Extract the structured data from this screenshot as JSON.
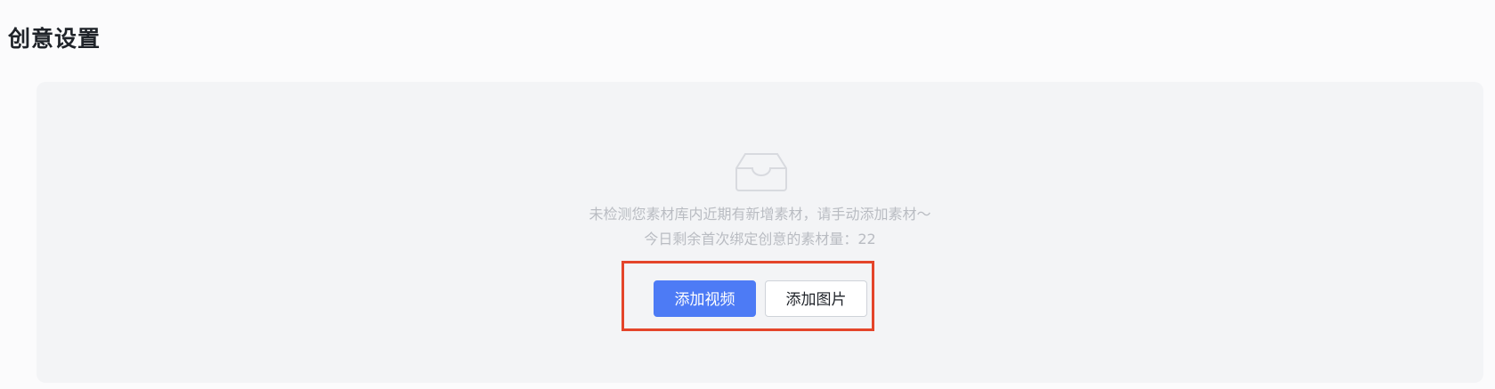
{
  "section": {
    "title": "创意设置"
  },
  "empty_state": {
    "icon": "inbox-icon",
    "message_line1": "未检测您素材库内近期有新增素材，请手动添加素材～",
    "message_line2": "今日剩余首次绑定创意的素材量：22"
  },
  "actions": {
    "add_video_label": "添加视频",
    "add_image_label": "添加图片"
  },
  "colors": {
    "primary": "#4d7bf5",
    "highlight": "#e4452a",
    "panel_bg": "#f3f4f6"
  }
}
